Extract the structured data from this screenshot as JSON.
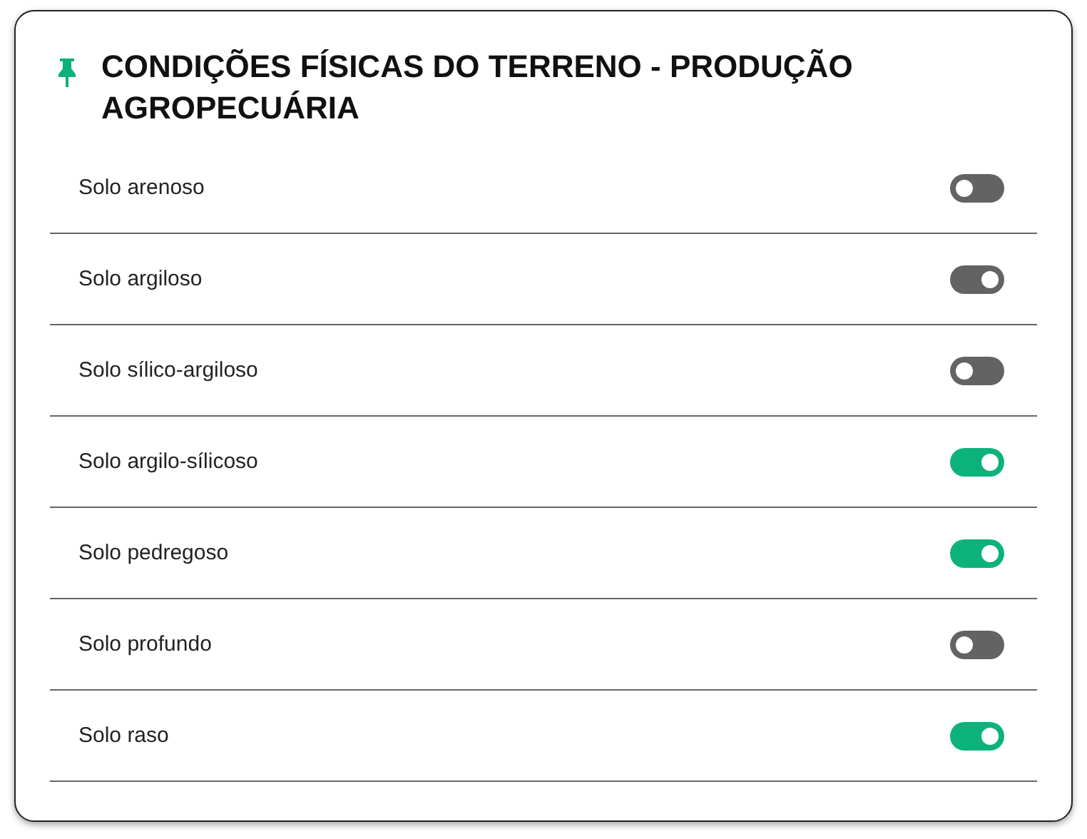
{
  "title": "CONDIÇÕES FÍSICAS DO TERRENO - PRODUÇÃO AGROPECUÁRIA",
  "options": [
    {
      "label": "Solo arenoso",
      "on": false,
      "color": "#636363"
    },
    {
      "label": "Solo argiloso",
      "on": true,
      "color": "#636363"
    },
    {
      "label": "Solo sílico-argiloso",
      "on": false,
      "color": "#636363"
    },
    {
      "label": "Solo argilo-sílicoso",
      "on": true,
      "color": "#0db27a"
    },
    {
      "label": "Solo pedregoso",
      "on": true,
      "color": "#0db27a"
    },
    {
      "label": "Solo profundo",
      "on": false,
      "color": "#636363"
    },
    {
      "label": "Solo raso",
      "on": true,
      "color": "#0db27a"
    }
  ]
}
